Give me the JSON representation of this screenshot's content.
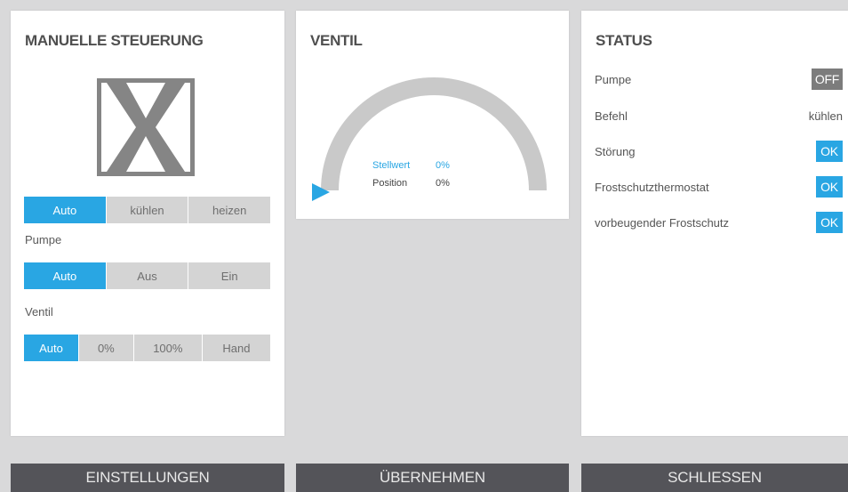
{
  "manual": {
    "title": "MANUELLE STEUERUNG",
    "mode_options": [
      "Auto",
      "kühlen",
      "heizen"
    ],
    "pump_label": "Pumpe",
    "pump_options": [
      "Auto",
      "Aus",
      "Ein"
    ],
    "valve_label": "Ventil",
    "valve_options": [
      "Auto",
      "0%",
      "100%",
      "Hand"
    ]
  },
  "valve": {
    "title": "VENTIL",
    "setpoint_label": "Stellwert",
    "setpoint_value": "0%",
    "position_label": "Position",
    "position_value": "0%",
    "gauge_fraction": 0
  },
  "status": {
    "title": "STATUS",
    "rows": [
      {
        "label": "Pumpe",
        "value": "OFF",
        "kind": "off"
      },
      {
        "label": "Befehl",
        "value": "kühlen",
        "kind": "text"
      },
      {
        "label": "Störung",
        "value": "OK",
        "kind": "ok"
      },
      {
        "label": "Frostschutzthermostat",
        "value": "OK",
        "kind": "ok"
      },
      {
        "label": "vorbeugender Frostschutz",
        "value": "OK",
        "kind": "ok"
      }
    ]
  },
  "buttons": {
    "settings": "EINSTELLUNGEN",
    "apply": "ÜBERNEHMEN",
    "close": "SCHLIESSEN"
  },
  "colors": {
    "accent": "#29a6e3",
    "off": "#7c7c7c",
    "bar": "#545459"
  }
}
